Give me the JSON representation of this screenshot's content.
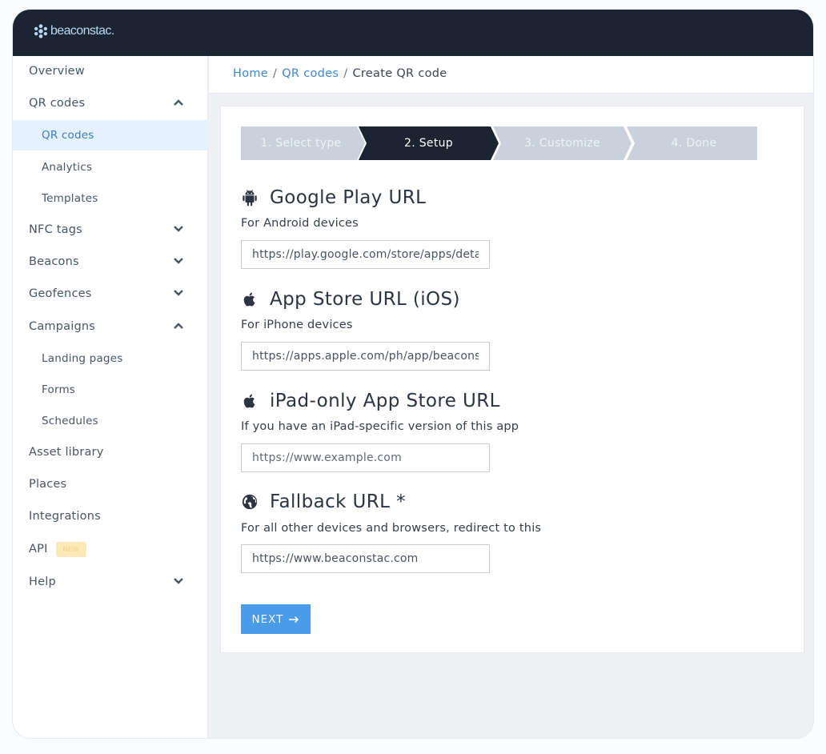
{
  "app": {
    "logo_text": "beaconstac."
  },
  "sidebar": {
    "items": [
      {
        "label": "Overview",
        "sub": false,
        "chevron": ""
      },
      {
        "label": "QR codes",
        "sub": false,
        "chevron": "up"
      },
      {
        "label": "QR codes",
        "sub": true,
        "active": true
      },
      {
        "label": "Analytics",
        "sub": true
      },
      {
        "label": "Templates",
        "sub": true
      },
      {
        "label": "NFC tags",
        "sub": false,
        "chevron": "down"
      },
      {
        "label": "Beacons",
        "sub": false,
        "chevron": "down"
      },
      {
        "label": "Geofences",
        "sub": false,
        "chevron": "down"
      },
      {
        "label": "Campaigns",
        "sub": false,
        "chevron": "up"
      },
      {
        "label": "Landing pages",
        "sub": true
      },
      {
        "label": "Forms",
        "sub": true
      },
      {
        "label": "Schedules",
        "sub": true
      },
      {
        "label": "Asset library",
        "sub": false
      },
      {
        "label": "Places",
        "sub": false
      },
      {
        "label": "Integrations",
        "sub": false
      },
      {
        "label": "API",
        "sub": false,
        "badge": "NEW"
      },
      {
        "label": "Help",
        "sub": false,
        "chevron": "down"
      }
    ]
  },
  "breadcrumb": {
    "home": "Home",
    "qr_codes": "QR codes",
    "current": "Create QR code",
    "separator": "/"
  },
  "stepper": {
    "steps": [
      {
        "label": "1. Select type",
        "state": "completed"
      },
      {
        "label": "2. Setup",
        "state": "active"
      },
      {
        "label": "3. Customize",
        "state": "upcoming"
      },
      {
        "label": "4. Done",
        "state": "upcoming"
      }
    ],
    "colors": {
      "active": "#1b2431",
      "inactive": "#c9d2dc"
    }
  },
  "form": {
    "google_play": {
      "title": "Google Play URL",
      "icon": "android-icon",
      "description": "For Android devices",
      "value": "https://play.google.com/store/apps/details?id=com.beaconstac",
      "placeholder": ""
    },
    "app_store": {
      "title": "App Store URL (iOS)",
      "icon": "apple-icon",
      "description": "For iPhone devices",
      "value": "https://apps.apple.com/ph/app/beaconstac",
      "placeholder": ""
    },
    "ipad_store": {
      "title": "iPad-only App Store URL",
      "icon": "apple-icon",
      "description": "If you have an iPad-specific version of this app",
      "value": "",
      "placeholder": "https://www.example.com"
    },
    "fallback": {
      "title": "Fallback URL *",
      "icon": "globe-icon",
      "description": "For all other devices and browsers, redirect to this",
      "value": "https://www.beaconstac.com",
      "placeholder": ""
    }
  },
  "actions": {
    "next_label": "NEXT",
    "next_icon": "arrow-right-icon"
  },
  "colors": {
    "topbar": "#1b2431",
    "link": "#3d86d1",
    "primary_button": "#4a9be8",
    "active_nav_bg": "#e5f1fd"
  }
}
